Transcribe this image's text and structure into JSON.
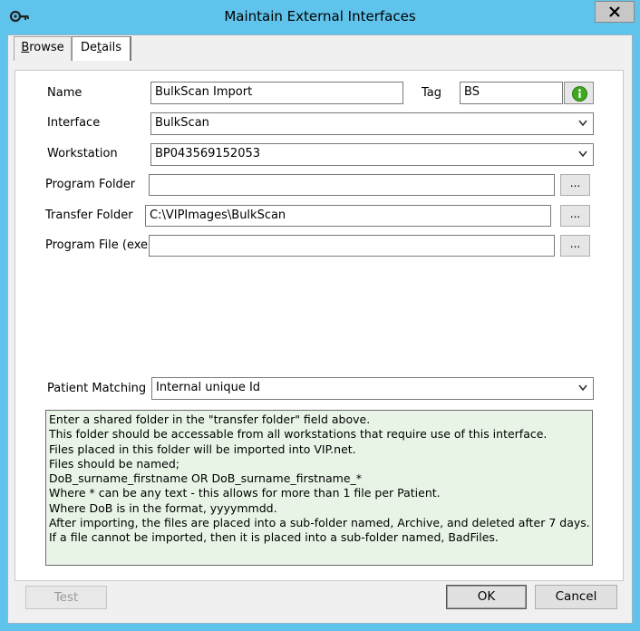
{
  "window": {
    "title": "Maintain External Interfaces"
  },
  "tabs": [
    {
      "label_prefix": "",
      "label_ul": "B",
      "label_rest": "rowse"
    },
    {
      "label_prefix": "De",
      "label_ul": "t",
      "label_rest": "ails"
    }
  ],
  "form": {
    "name": {
      "label": "Name",
      "value": "BulkScan Import"
    },
    "tag": {
      "label": "Tag",
      "value": "BS"
    },
    "interface": {
      "label": "Interface",
      "value": "BulkScan"
    },
    "workstation": {
      "label": "Workstation",
      "value": "BP043569152053"
    },
    "program_folder": {
      "label": "Program Folder",
      "value": "",
      "browse": "..."
    },
    "transfer_folder": {
      "label": "Transfer Folder",
      "value": "C:\\VIPImages\\BulkScan",
      "browse": "..."
    },
    "program_file": {
      "label": "Program File (exe)",
      "value": "",
      "browse": "..."
    },
    "patient_matching": {
      "label": "Patient Matching",
      "value": "Internal unique Id"
    }
  },
  "notes": [
    "Enter a shared folder in the \"transfer folder\" field above.",
    "This folder should be accessable from all workstations that require use of this interface.",
    "Files placed in this folder will be imported into VIP.net.",
    "Files should be named;",
    "DoB_surname_firstname OR DoB_surname_firstname_*",
    "Where * can be any text - this allows for more than 1 file per Patient.",
    "Where DoB is in the format, yyyymmdd.",
    "After importing, the files are placed into a sub-folder named, Archive, and deleted after 7 days.",
    "If a file cannot be imported, then it is placed into a sub-folder named, BadFiles."
  ],
  "buttons": {
    "test": "Test",
    "ok": "OK",
    "cancel": "Cancel"
  },
  "colors": {
    "titlebar": "#5fc3ec",
    "notes_bg": "#e8f5e6",
    "info_icon": "#3ea81e"
  },
  "icons": {
    "app": "key-icon",
    "close": "close-icon",
    "info": "info-icon",
    "dropdown": "chevron-down-icon"
  }
}
